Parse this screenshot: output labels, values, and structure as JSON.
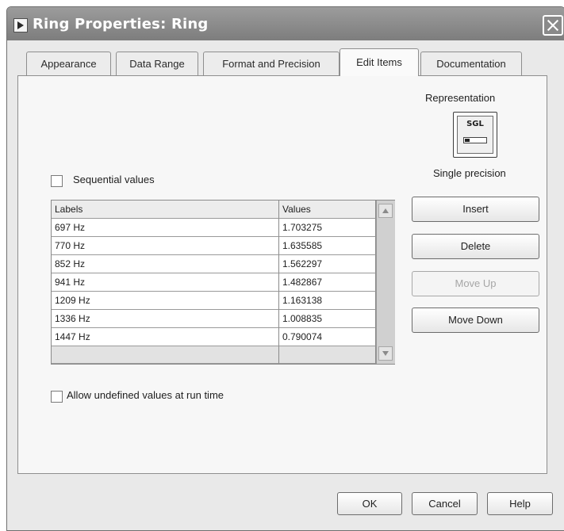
{
  "window": {
    "title": "Ring Properties: Ring"
  },
  "tabs": [
    {
      "label": "Appearance",
      "active": false
    },
    {
      "label": "Data Range",
      "active": false
    },
    {
      "label": "Format and Precision",
      "active": false
    },
    {
      "label": "Edit Items",
      "active": true
    },
    {
      "label": "Documentation",
      "active": false
    }
  ],
  "representation": {
    "label": "Representation",
    "icon_text": "SGL",
    "type": "Single precision"
  },
  "sequential_values": {
    "label": "Sequential values",
    "checked": false
  },
  "items_table": {
    "headers": {
      "labels": "Labels",
      "values": "Values"
    },
    "rows": [
      {
        "label": "697 Hz",
        "value": "1.703275"
      },
      {
        "label": "770 Hz",
        "value": "1.635585"
      },
      {
        "label": "852 Hz",
        "value": "1.562297"
      },
      {
        "label": "941 Hz",
        "value": "1.482867"
      },
      {
        "label": "1209 Hz",
        "value": "1.163138"
      },
      {
        "label": "1336 Hz",
        "value": "1.008835"
      },
      {
        "label": "1447 Hz",
        "value": "0.790074"
      }
    ]
  },
  "actions": {
    "insert": "Insert",
    "delete": "Delete",
    "move_up": "Move Up",
    "move_down": "Move Down"
  },
  "allow_undefined": {
    "label": "Allow undefined values at run time",
    "checked": false
  },
  "footer": {
    "ok": "OK",
    "cancel": "Cancel",
    "help": "Help"
  }
}
